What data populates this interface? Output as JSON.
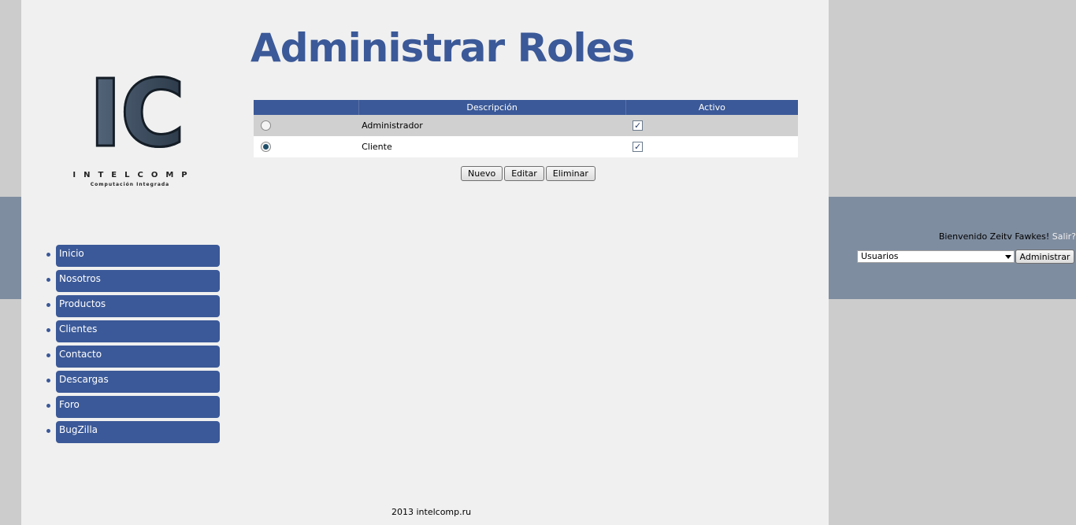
{
  "logo": {
    "letters": "IC",
    "name": "INTELCOMP",
    "tagline": "Computación Integrada"
  },
  "title": "Administrar Roles",
  "table": {
    "headers": [
      "",
      "Descripción",
      "Activo"
    ],
    "rows": [
      {
        "selected": false,
        "description": "Administrador",
        "active": true
      },
      {
        "selected": true,
        "description": "Cliente",
        "active": true
      }
    ]
  },
  "actions": {
    "new_label": "Nuevo",
    "edit_label": "Editar",
    "delete_label": "Eliminar"
  },
  "nav": {
    "items": [
      {
        "label": "Inicio"
      },
      {
        "label": "Nosotros"
      },
      {
        "label": "Productos"
      },
      {
        "label": "Clientes"
      },
      {
        "label": "Contacto"
      },
      {
        "label": "Descargas"
      },
      {
        "label": "Foro"
      },
      {
        "label": "BugZilla"
      }
    ]
  },
  "user_panel": {
    "welcome_text": "Bienvenido Zeitv Fawkes!",
    "logout_label": "Salir?",
    "select_value": "Usuarios",
    "admin_button": "Administrar"
  },
  "footer": {
    "text": "2013 intelcomp.ru"
  },
  "colors": {
    "accent": "#3b5998",
    "band": "#7f8da0",
    "page_bg": "#f0f0f0",
    "outer_bg": "#cccccc"
  }
}
